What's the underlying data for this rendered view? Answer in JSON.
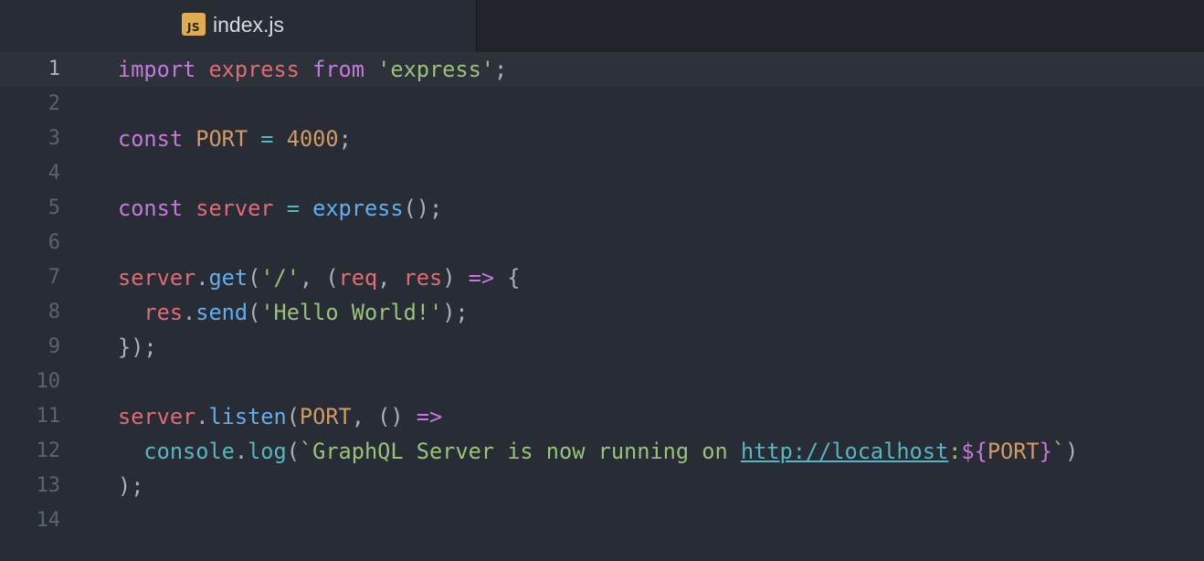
{
  "tab": {
    "icon_label": "JS",
    "title": "index.js"
  },
  "lines": [
    {
      "number": "1",
      "tokens": [
        {
          "text": "import",
          "type": "kw"
        },
        {
          "text": " ",
          "type": "pn"
        },
        {
          "text": "express",
          "type": "var"
        },
        {
          "text": " ",
          "type": "pn"
        },
        {
          "text": "from",
          "type": "kw"
        },
        {
          "text": " ",
          "type": "pn"
        },
        {
          "text": "'express'",
          "type": "str"
        },
        {
          "text": ";",
          "type": "pn"
        }
      ]
    },
    {
      "number": "2",
      "tokens": []
    },
    {
      "number": "3",
      "tokens": [
        {
          "text": "const",
          "type": "kw"
        },
        {
          "text": " ",
          "type": "pn"
        },
        {
          "text": "PORT",
          "type": "num"
        },
        {
          "text": " ",
          "type": "pn"
        },
        {
          "text": "=",
          "type": "op"
        },
        {
          "text": " ",
          "type": "pn"
        },
        {
          "text": "4000",
          "type": "num"
        },
        {
          "text": ";",
          "type": "pn"
        }
      ]
    },
    {
      "number": "4",
      "tokens": []
    },
    {
      "number": "5",
      "tokens": [
        {
          "text": "const",
          "type": "kw"
        },
        {
          "text": " ",
          "type": "pn"
        },
        {
          "text": "server",
          "type": "var"
        },
        {
          "text": " ",
          "type": "pn"
        },
        {
          "text": "=",
          "type": "op"
        },
        {
          "text": " ",
          "type": "pn"
        },
        {
          "text": "express",
          "type": "fn"
        },
        {
          "text": "();",
          "type": "pn"
        }
      ]
    },
    {
      "number": "6",
      "tokens": []
    },
    {
      "number": "7",
      "tokens": [
        {
          "text": "server",
          "type": "var"
        },
        {
          "text": ".",
          "type": "pn"
        },
        {
          "text": "get",
          "type": "fn"
        },
        {
          "text": "(",
          "type": "pn"
        },
        {
          "text": "'/'",
          "type": "str"
        },
        {
          "text": ", (",
          "type": "pn"
        },
        {
          "text": "req",
          "type": "var"
        },
        {
          "text": ", ",
          "type": "pn"
        },
        {
          "text": "res",
          "type": "var"
        },
        {
          "text": ") ",
          "type": "pn"
        },
        {
          "text": "=>",
          "type": "kw"
        },
        {
          "text": " {",
          "type": "pn"
        }
      ]
    },
    {
      "number": "8",
      "tokens": [
        {
          "text": "  ",
          "type": "pn"
        },
        {
          "text": "res",
          "type": "var"
        },
        {
          "text": ".",
          "type": "pn"
        },
        {
          "text": "send",
          "type": "fn"
        },
        {
          "text": "(",
          "type": "pn"
        },
        {
          "text": "'Hello World!'",
          "type": "str"
        },
        {
          "text": ");",
          "type": "pn"
        }
      ]
    },
    {
      "number": "9",
      "tokens": [
        {
          "text": "});",
          "type": "pn"
        }
      ]
    },
    {
      "number": "10",
      "tokens": []
    },
    {
      "number": "11",
      "tokens": [
        {
          "text": "server",
          "type": "var"
        },
        {
          "text": ".",
          "type": "pn"
        },
        {
          "text": "listen",
          "type": "fn"
        },
        {
          "text": "(",
          "type": "pn"
        },
        {
          "text": "PORT",
          "type": "num"
        },
        {
          "text": ", () ",
          "type": "pn"
        },
        {
          "text": "=>",
          "type": "kw"
        }
      ]
    },
    {
      "number": "12",
      "tokens": [
        {
          "text": "  ",
          "type": "pn"
        },
        {
          "text": "console",
          "type": "op"
        },
        {
          "text": ".",
          "type": "pn"
        },
        {
          "text": "log",
          "type": "op"
        },
        {
          "text": "(",
          "type": "pn"
        },
        {
          "text": "`GraphQL Server is now running on ",
          "type": "str"
        },
        {
          "text": "http://localhost",
          "type": "url"
        },
        {
          "text": ":",
          "type": "str"
        },
        {
          "text": "${",
          "type": "interp"
        },
        {
          "text": "PORT",
          "type": "num"
        },
        {
          "text": "}",
          "type": "interp"
        },
        {
          "text": "`",
          "type": "str"
        },
        {
          "text": ")",
          "type": "pn"
        }
      ]
    },
    {
      "number": "13",
      "tokens": [
        {
          "text": ");",
          "type": "pn"
        }
      ]
    },
    {
      "number": "14",
      "tokens": []
    }
  ],
  "active_line": 1,
  "colors": {
    "background": "#282c34",
    "keyword": "#c678dd",
    "variable": "#e06c75",
    "string": "#98c379",
    "number": "#d19a66",
    "function": "#61afef",
    "operator": "#56b6c2",
    "js_icon": "#e0ac4f"
  }
}
